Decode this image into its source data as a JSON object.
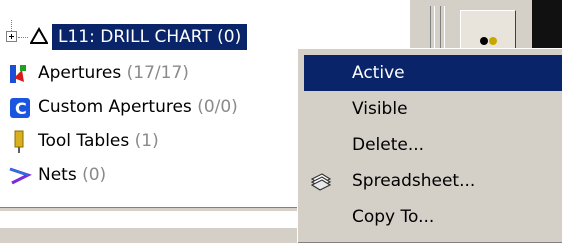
{
  "tree": {
    "layer": {
      "label": "L11: DRILL CHART (0)"
    },
    "items": [
      {
        "name": "Apertures",
        "count": "(17/17)",
        "icon": "apertures-icon"
      },
      {
        "name": "Custom Apertures",
        "count": "(0/0)",
        "icon": "custom-apertures-icon"
      },
      {
        "name": "Tool Tables",
        "count": "(1)",
        "icon": "tool-tables-icon"
      },
      {
        "name": "Nets",
        "count": "(0)",
        "icon": "nets-icon"
      }
    ]
  },
  "context_menu": {
    "items": [
      {
        "label": "Active",
        "highlighted": true
      },
      {
        "label": "Visible"
      },
      {
        "label": "Delete..."
      },
      {
        "label": "Spreadsheet...",
        "icon": "spreadsheet-icon"
      },
      {
        "label": "Copy To..."
      }
    ]
  },
  "colors": {
    "selection": "#0a246a",
    "menu_bg": "#d4d0c8",
    "count_text": "#8a8a8a"
  }
}
